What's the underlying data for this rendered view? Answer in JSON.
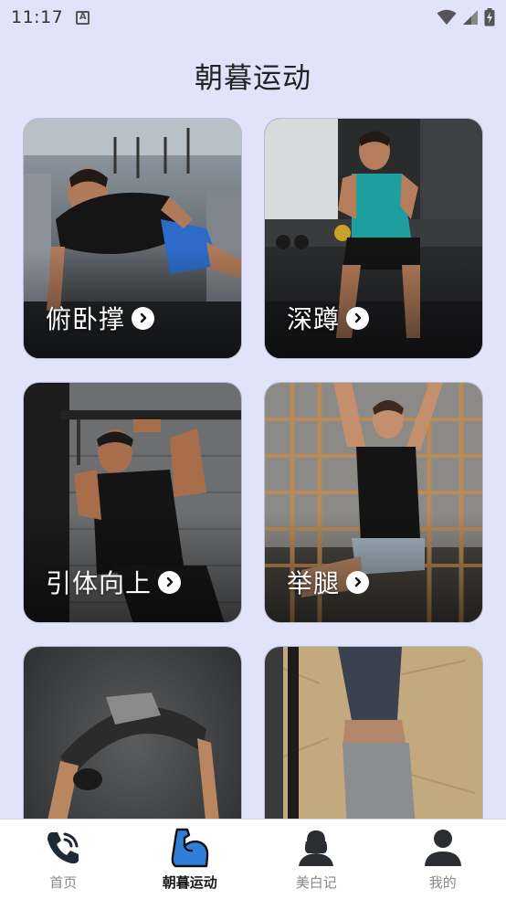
{
  "status_bar": {
    "time": "11:17",
    "notification_letter": "A"
  },
  "title": "朝暮运动",
  "cards": [
    {
      "label": "俯卧撑",
      "image": "man-doing-one-arm-pushup-in-gym"
    },
    {
      "label": "深蹲",
      "image": "man-doing-squat-in-dark-gym"
    },
    {
      "label": "引体向上",
      "image": "man-doing-pull-up-by-brick-wall"
    },
    {
      "label": "举腿",
      "image": "man-hanging-leg-raise-on-bars"
    },
    {
      "label": "",
      "image": "man-doing-backbend-bridge"
    },
    {
      "label": "",
      "image": "man-doing-handstand-against-wall"
    }
  ],
  "nav": {
    "items": [
      {
        "label": "首页",
        "icon": "phone-icon",
        "active": false
      },
      {
        "label": "朝暮运动",
        "icon": "flexed-arm-icon",
        "active": true
      },
      {
        "label": "美白记",
        "icon": "woman-silhouette-icon",
        "active": false
      },
      {
        "label": "我的",
        "icon": "person-icon",
        "active": false
      }
    ]
  },
  "colors": {
    "background": "#e1e3fb",
    "accent": "#2f7fd8",
    "nav_background": "#ffffff"
  }
}
